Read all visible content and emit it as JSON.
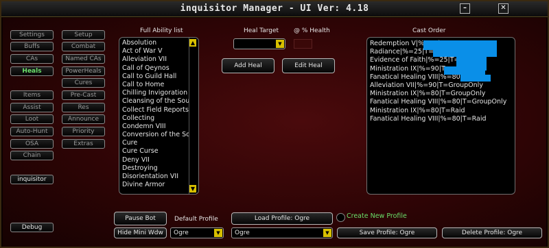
{
  "window": {
    "title": "inquisitor Manager   - UI Ver: 4.18",
    "minimize_label": "–",
    "close_label": "✕"
  },
  "sidebar": {
    "left_buttons": [
      "Settings",
      "Buffs",
      "CAs",
      "Heals",
      "Items",
      "Assist",
      "Loot",
      "Auto-Hunt",
      "OSA",
      "Chain"
    ],
    "right_buttons": [
      "Setup",
      "Combat",
      "Named CAs",
      "PowerHeals",
      "Cures",
      "Pre-Cast",
      "Res",
      "Announce",
      "Priority",
      "Extras"
    ],
    "active": "Heals",
    "class_button": "inquisitor",
    "debug_button": "Debug"
  },
  "abilities": {
    "header": "Full Ability list",
    "items": [
      "Absolution",
      "Act of War V",
      "Alleviation VII",
      "Call of Qeynos",
      "Call to Guild Hall",
      "Call to Home",
      "Chilling Invigoration",
      "Cleansing of the Soul",
      "Collect Field Reports",
      "Collecting",
      "Condemn VIII",
      "Conversion of the Soul",
      "Cure",
      "Cure Curse",
      "Deny VII",
      "Destroying",
      "Disorientation VII",
      "Divine Armor"
    ]
  },
  "heal_target": {
    "header": "Heal Target",
    "value": "",
    "health_header": "@ % Health",
    "health_value": ""
  },
  "actions": {
    "add_heal": "Add Heal",
    "edit_heal": "Edit Heal"
  },
  "cast_order": {
    "header": "Cast Order",
    "items": [
      "Redemption V|%=25|T=",
      "Radiance|%=25|T=",
      "Evidence of Faith|%=25|T=",
      "Ministration IX|%=90|T=",
      "Fanatical Healing VIII|%=80|T=",
      "Alleviation VII|%=90|T=GroupOnly",
      "Ministration IX|%=80|T=GroupOnly",
      "Fanatical Healing VIII|%=80|T=GroupOnly",
      "Ministration IX|%=80|T=Raid",
      "Fanatical Healing VIII|%=80|T=Raid"
    ],
    "redaction_color": "#0a8fe8"
  },
  "bottom": {
    "pause_bot": "Pause Bot",
    "hide_mini": "Hide Mini Wdw",
    "default_profile_label": "Default Profile",
    "default_profile_value": "Ogre",
    "load_profile": "Load Profile: Ogre",
    "profile_value": "Ogre",
    "create_new_profile": "Create New Profile",
    "save_profile": "Save Profile: Ogre",
    "delete_profile": "Delete Profile: Ogre"
  },
  "colors": {
    "active_text": "#6ae06a",
    "accent_yellow": "#d8c000",
    "panel_red": "#4a0a0c"
  }
}
